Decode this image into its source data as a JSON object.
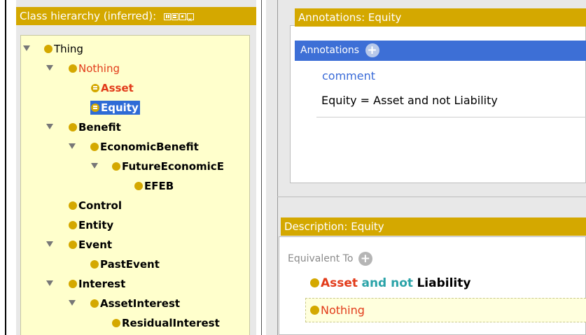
{
  "left_panel": {
    "title": "Class hierarchy (inferred):",
    "header_icons": [
      "view-icon-1",
      "view-icon-2",
      "view-icon-3",
      "close-view-icon"
    ],
    "tree": [
      {
        "label": "Thing"
      },
      {
        "label": "Nothing"
      },
      {
        "label": "Asset"
      },
      {
        "label": "Equity"
      },
      {
        "label": "Benefit"
      },
      {
        "label": "EconomicBenefit"
      },
      {
        "label": "FutureEconomicE"
      },
      {
        "label": "EFEB"
      },
      {
        "label": "Control"
      },
      {
        "label": "Entity"
      },
      {
        "label": "Event"
      },
      {
        "label": "PastEvent"
      },
      {
        "label": "Interest"
      },
      {
        "label": "AssetInterest"
      },
      {
        "label": "ResidualInterest"
      }
    ]
  },
  "annotations_panel": {
    "title": "Annotations: Equity",
    "sub_header": "Annotations",
    "add_symbol": "+",
    "property": "comment",
    "value": "Equity = Asset and not Liability"
  },
  "description_panel": {
    "title": "Description: Equity",
    "section_label": "Equivalent To",
    "add_symbol": "+",
    "expr_first": "Asset",
    "expr_operator": "and not",
    "expr_second": "Liability",
    "inferred_item": "Nothing"
  },
  "colors": {
    "header": "#d4a800",
    "selection": "#2e6bd6",
    "tree_bg": "#ffffcc",
    "unsatisfiable_red": "#e23b1a",
    "keyword_teal": "#2aa3a8"
  }
}
